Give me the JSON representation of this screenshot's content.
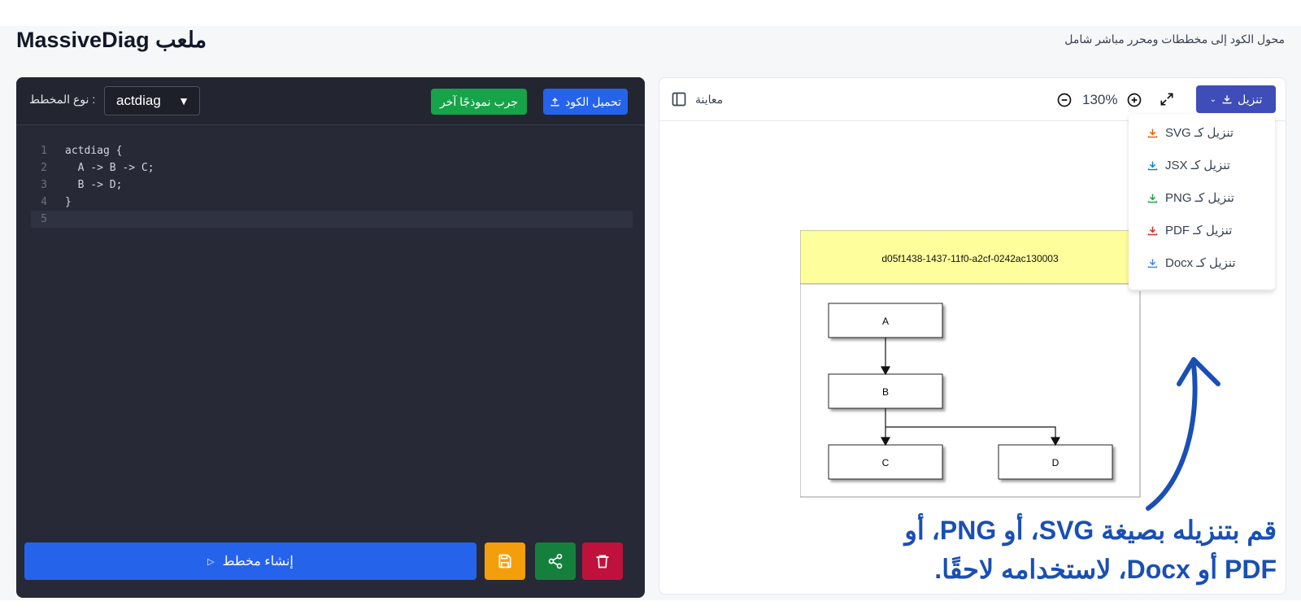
{
  "header": {
    "app_title": "ملعب MassiveDiag",
    "subtitle": "محول الكود إلى مخططات ومحرر مباشر شامل"
  },
  "editor": {
    "upload_button": "تحميل الكود",
    "sample_button": "جرب نموذجًا آخر",
    "diagram_type_value": "actdiag",
    "diagram_type_label": ": نوع المخطط",
    "code_lines": [
      {
        "num": "1",
        "text": "actdiag {"
      },
      {
        "num": "2",
        "text": "  A -> B -> C;"
      },
      {
        "num": "3",
        "text": "  B -> D;"
      },
      {
        "num": "4",
        "text": "}"
      },
      {
        "num": "5",
        "text": ""
      }
    ],
    "generate_button": "إنشاء مخطط",
    "colors": {
      "panel_bg": "#272a36",
      "generate": "#2563eb",
      "save": "#f59e0b",
      "share": "#15803d",
      "delete": "#be123c"
    }
  },
  "preview": {
    "label": "معاينة",
    "zoom_level": "130%",
    "download_button": "تنزيل",
    "download_menu": [
      {
        "label": "تنزيل كـ SVG",
        "icon": "download-icon",
        "color": "#ea580c"
      },
      {
        "label": "تنزيل كـ JSX",
        "icon": "download-icon",
        "color": "#0284c7"
      },
      {
        "label": "تنزيل كـ PNG",
        "icon": "download-icon",
        "color": "#16a34a"
      },
      {
        "label": "تنزيل كـ PDF",
        "icon": "download-icon",
        "color": "#dc2626"
      },
      {
        "label": "تنزيل كـ Docx",
        "icon": "download-icon",
        "color": "#3b82f6"
      }
    ],
    "diagram": {
      "header_text": "d05f1438-1437-11f0-a2cf-0242ac130003",
      "nodes": [
        "A",
        "B",
        "C",
        "D"
      ]
    }
  },
  "annotation": {
    "line1": "قم بتنزيله بصيغة SVG، أو PNG، أو",
    "line2": "PDF أو Docx، لاستخدامه لاحقًا.",
    "color": "#1a4fb3"
  }
}
